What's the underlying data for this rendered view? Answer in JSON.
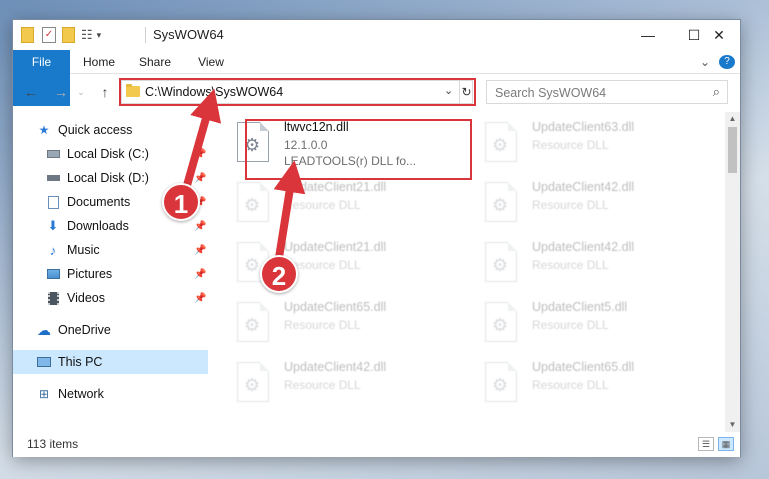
{
  "window": {
    "title": "SysWOW64",
    "controls": {
      "minimize": "—",
      "maximize": "☐",
      "close": "✕"
    }
  },
  "ribbon": {
    "tabs": [
      "File",
      "Home",
      "Share",
      "View"
    ],
    "expand_glyph": "⌄",
    "help_glyph": "?"
  },
  "address_bar": {
    "path": "C:\\Windows\\SysWOW64"
  },
  "search": {
    "placeholder": "Search SysWOW64"
  },
  "nav_pane": {
    "items": [
      {
        "label": "Quick access",
        "icon": "star-icon"
      },
      {
        "label": "Local Disk (C:)",
        "icon": "drive-icon"
      },
      {
        "label": "Local Disk (D:)",
        "icon": "drive-icon"
      },
      {
        "label": "Documents",
        "icon": "documents-icon"
      },
      {
        "label": "Downloads",
        "icon": "downloads-icon"
      },
      {
        "label": "Music",
        "icon": "music-icon"
      },
      {
        "label": "Pictures",
        "icon": "pictures-icon"
      },
      {
        "label": "Videos",
        "icon": "videos-icon"
      },
      {
        "label": "OneDrive",
        "icon": "cloud-icon"
      },
      {
        "label": "This PC",
        "icon": "computer-icon"
      },
      {
        "label": "Network",
        "icon": "network-icon"
      }
    ]
  },
  "files": [
    {
      "name": "ltwvc12n.dll",
      "line1": "12.1.0.0",
      "line2": "LEADTOOLS(r) DLL fo..."
    },
    {
      "name": "UpdateClient63.dll",
      "line1": "Resource DLL"
    },
    {
      "name": "UpdateClient21.dll",
      "line1": "Resource DLL"
    },
    {
      "name": "UpdateClient42.dll",
      "line1": "Resource DLL"
    },
    {
      "name": "UpdateClient21.dll",
      "line1": "Resource DLL"
    },
    {
      "name": "UpdateClient42.dll",
      "line1": "Resource DLL"
    },
    {
      "name": "UpdateClient65.dll",
      "line1": "Resource DLL"
    },
    {
      "name": "UpdateClient5.dll",
      "line1": "Resource DLL"
    },
    {
      "name": "UpdateClient42.dll",
      "line1": "Resource DLL"
    },
    {
      "name": "UpdateClient65.dll",
      "line1": "Resource DLL"
    }
  ],
  "status": {
    "item_count": "113 items"
  },
  "annotations": {
    "step1": "1",
    "step2": "2",
    "color": "#d9353a"
  }
}
